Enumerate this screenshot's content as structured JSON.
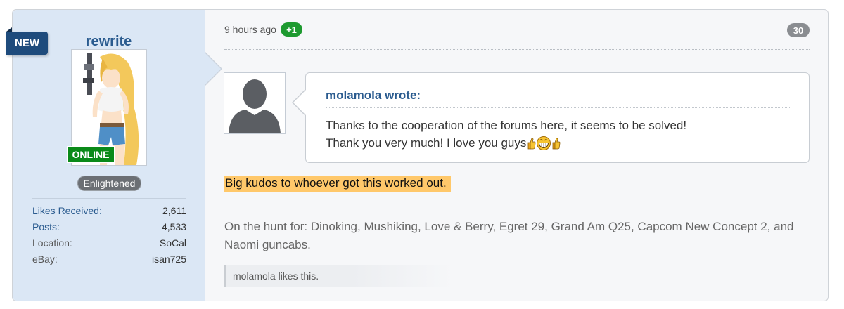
{
  "user": {
    "new_label": "NEW",
    "username": "rewrite",
    "online_label": "ONLINE",
    "rank": "Enlightened",
    "stats": [
      {
        "label": "Likes Received:",
        "value": "2,611",
        "link": true
      },
      {
        "label": "Posts:",
        "value": "4,533",
        "link": true
      },
      {
        "label": "Location:",
        "value": "SoCal",
        "link": false
      },
      {
        "label": "eBay:",
        "value": "isan725",
        "link": false
      }
    ]
  },
  "post": {
    "time": "9 hours ago",
    "plus_badge": "+1",
    "post_number": "30",
    "quote": {
      "author": "molamola wrote:",
      "line1": "Thanks to the cooperation of the forums here, it seems to be solved!",
      "line2": "Thank you very much! I love you guys"
    },
    "highlight": "Big kudos to whoever got this worked out.",
    "signature": "On the hunt for: Dinoking, Mushiking, Love & Berry, Egret 29, Grand Am Q25, Capcom New Concept 2, and Naomi guncabs.",
    "likes": "molamola likes this."
  },
  "colors": {
    "link": "#2a5b8f",
    "user_col_bg": "#dbe7f5",
    "online": "#0a8a19",
    "highlight": "#ffc86a"
  },
  "icons": [
    "thumbs-up-icon",
    "grin-emoji-icon",
    "default-avatar-icon"
  ]
}
